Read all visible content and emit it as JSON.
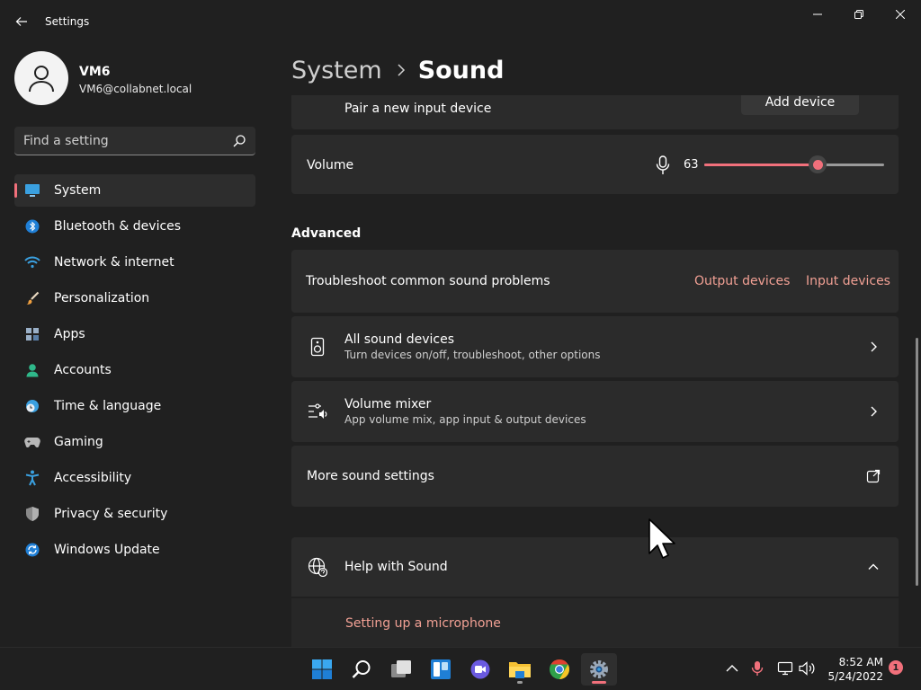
{
  "window": {
    "app_title": "Settings"
  },
  "profile": {
    "name": "VM6",
    "email": "VM6@collabnet.local"
  },
  "search": {
    "placeholder": "Find a setting"
  },
  "sidebar": {
    "items": [
      {
        "label": "System",
        "icon": "system-monitor-icon",
        "active": true
      },
      {
        "label": "Bluetooth & devices",
        "icon": "bluetooth-icon"
      },
      {
        "label": "Network & internet",
        "icon": "wifi-icon"
      },
      {
        "label": "Personalization",
        "icon": "brush-icon"
      },
      {
        "label": "Apps",
        "icon": "apps-icon"
      },
      {
        "label": "Accounts",
        "icon": "person-icon"
      },
      {
        "label": "Time & language",
        "icon": "clock-globe-icon"
      },
      {
        "label": "Gaming",
        "icon": "gamepad-icon"
      },
      {
        "label": "Accessibility",
        "icon": "accessibility-icon"
      },
      {
        "label": "Privacy & security",
        "icon": "shield-icon"
      },
      {
        "label": "Windows Update",
        "icon": "update-icon"
      }
    ]
  },
  "breadcrumb": {
    "parent": "System",
    "current": "Sound"
  },
  "main": {
    "pair_input": {
      "label": "Pair a new input device",
      "button": "Add device"
    },
    "volume": {
      "label": "Volume",
      "value": "63",
      "level": 63
    },
    "advanced": {
      "heading": "Advanced",
      "troubleshoot": {
        "label": "Troubleshoot common sound problems",
        "link_output": "Output devices",
        "link_input": "Input devices"
      },
      "all_devices": {
        "title": "All sound devices",
        "subtitle": "Turn devices on/off, troubleshoot, other options"
      },
      "mixer": {
        "title": "Volume mixer",
        "subtitle": "App volume mix, app input & output devices"
      },
      "more": {
        "title": "More sound settings"
      }
    },
    "help": {
      "title": "Help with Sound",
      "link": "Setting up a microphone"
    }
  },
  "taskbar": {
    "time": "8:52 AM",
    "date": "5/24/2022",
    "notifications": "1"
  },
  "colors": {
    "accent": "#f1707b",
    "link": "#f1a094",
    "background": "#202020",
    "card": "#2b2b2b"
  }
}
